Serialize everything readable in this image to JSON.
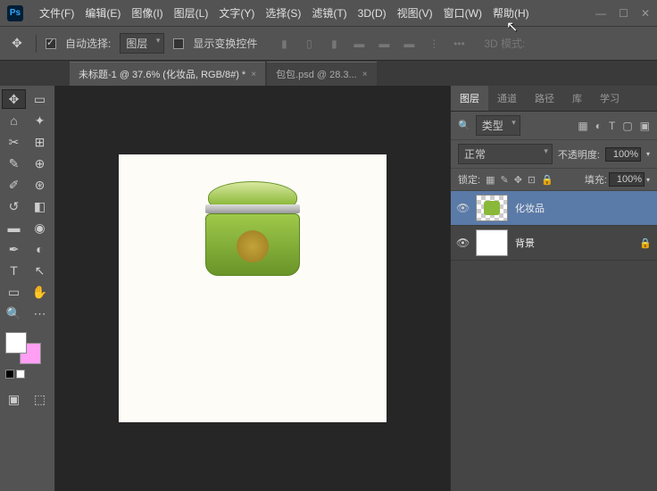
{
  "menubar": {
    "items": [
      "文件(F)",
      "编辑(E)",
      "图像(I)",
      "图层(L)",
      "文字(Y)",
      "选择(S)",
      "滤镜(T)",
      "3D(D)",
      "视图(V)",
      "窗口(W)",
      "帮助(H)"
    ]
  },
  "options": {
    "auto_select_label": "自动选择:",
    "target_dropdown": "图层",
    "show_transform_label": "显示变换控件",
    "mode_3d_label": "3D 模式:"
  },
  "tabs": [
    {
      "title": "未标题-1 @ 37.6% (化妆品, RGB/8#) *"
    },
    {
      "title": "包包.psd @ 28.3..."
    }
  ],
  "panels": {
    "tabs": [
      "图层",
      "通道",
      "路径",
      "库",
      "学习"
    ],
    "filter_label": "类型",
    "blend_mode": "正常",
    "opacity_label": "不透明度:",
    "opacity_value": "100%",
    "lock_label": "锁定:",
    "fill_label": "填充:",
    "fill_value": "100%",
    "layers": [
      {
        "name": "化妆品",
        "selected": true,
        "locked": false
      },
      {
        "name": "背景",
        "selected": false,
        "locked": true
      }
    ]
  }
}
